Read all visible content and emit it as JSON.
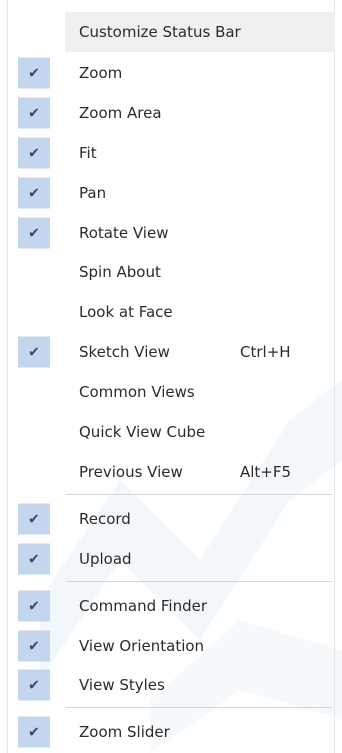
{
  "menu": {
    "header": "Customize Status Bar",
    "check_glyph": "✔",
    "items": [
      {
        "label": "Zoom",
        "checked": true,
        "shortcut": ""
      },
      {
        "label": "Zoom Area",
        "checked": true,
        "shortcut": ""
      },
      {
        "label": "Fit",
        "checked": true,
        "shortcut": ""
      },
      {
        "label": "Pan",
        "checked": true,
        "shortcut": ""
      },
      {
        "label": "Rotate View",
        "checked": true,
        "shortcut": ""
      },
      {
        "label": "Spin About",
        "checked": false,
        "shortcut": ""
      },
      {
        "label": "Look at Face",
        "checked": false,
        "shortcut": ""
      },
      {
        "label": "Sketch View",
        "checked": true,
        "shortcut": "Ctrl+H"
      },
      {
        "label": "Common Views",
        "checked": false,
        "shortcut": ""
      },
      {
        "label": "Quick View Cube",
        "checked": false,
        "shortcut": ""
      },
      {
        "label": "Previous View",
        "checked": false,
        "shortcut": "Alt+F5"
      },
      {
        "label": "Record",
        "checked": true,
        "shortcut": ""
      },
      {
        "label": "Upload",
        "checked": true,
        "shortcut": ""
      },
      {
        "label": "Command Finder",
        "checked": true,
        "shortcut": ""
      },
      {
        "label": "View Orientation",
        "checked": true,
        "shortcut": ""
      },
      {
        "label": "View Styles",
        "checked": true,
        "shortcut": ""
      },
      {
        "label": "Zoom Slider",
        "checked": true,
        "shortcut": ""
      }
    ]
  }
}
